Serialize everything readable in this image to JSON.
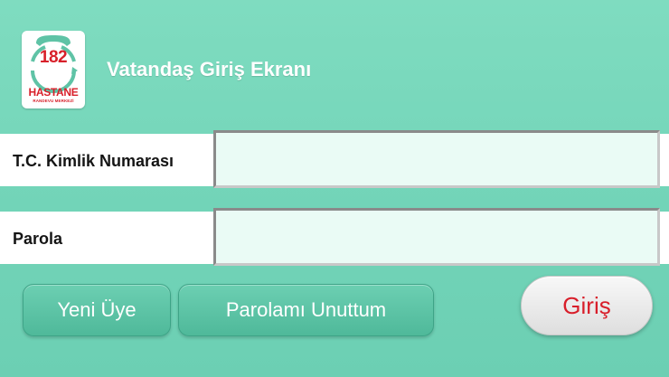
{
  "header": {
    "logo": {
      "number": "182",
      "brand": "HASTANE",
      "subtitle": "RANDEVU MERKEZİ"
    },
    "title": "Vatandaş Giriş Ekranı"
  },
  "form": {
    "id_label": "T.C. Kimlik Numarası",
    "id_value": "",
    "password_label": "Parola",
    "password_value": ""
  },
  "buttons": {
    "register": "Yeni Üye",
    "forgot": "Parolamı Unuttum",
    "login": "Giriş"
  },
  "colors": {
    "background": "#78d8bc",
    "brand_red": "#d8202a",
    "button_teal": "#5cc3a5"
  }
}
